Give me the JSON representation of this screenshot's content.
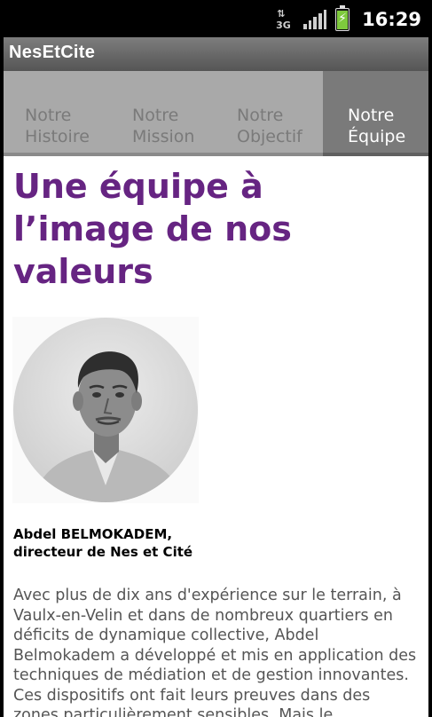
{
  "status_bar": {
    "network_type": "3G",
    "time": "16:29"
  },
  "app": {
    "title": "NesEtCite"
  },
  "tabs": [
    {
      "line1": "Notre",
      "line2": "Histoire",
      "active": false
    },
    {
      "line1": "Notre",
      "line2": "Mission",
      "active": false
    },
    {
      "line1": "Notre",
      "line2": "Objectif",
      "active": false
    },
    {
      "line1": "Notre",
      "line2": "Équipe",
      "active": true
    }
  ],
  "page": {
    "heading": "Une équipe à l’image de nos valeurs",
    "portrait_icon": "person-portrait",
    "caption_line1": "Abdel BELMOKADEM,",
    "caption_line2": "directeur de Nes et Cité",
    "body": "Avec plus de dix ans d'expérience sur le terrain, à Vaulx-en-Velin et dans de nombreux quartiers en déficits de dynamique collective, Abdel Belmokadem a développé et mis en application des techniques de médiation et de gestion innovantes. Ces dispositifs ont fait leurs preuves dans des zones particulièrement sensibles. Mais le"
  },
  "colors": {
    "heading": "#662482",
    "body_text": "#555555",
    "tab_active_bg": "#7a7a7a",
    "tab_bg": "#a9a9a9",
    "titlebar_bg": "#6a6a6a"
  }
}
